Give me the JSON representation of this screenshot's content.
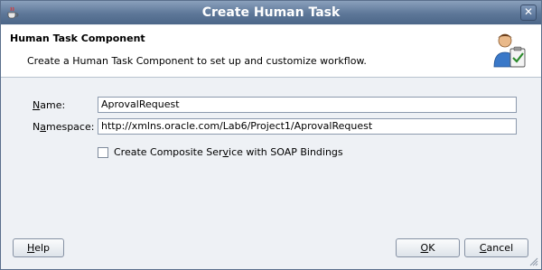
{
  "window": {
    "title": "Create Human Task"
  },
  "header": {
    "title": "Human Task Component",
    "description": "Create a Human Task Component to set up and customize workflow."
  },
  "form": {
    "name_label_mnemonic": "N",
    "name_label_rest": "ame:",
    "name_value": "AprovalRequest",
    "namespace_label_prefix": "N",
    "namespace_label_mnemonic": "a",
    "namespace_label_rest": "mespace:",
    "namespace_value": "http://xmlns.oracle.com/Lab6/Project1/AprovalRequest",
    "composite_checkbox_prefix": "Create Composite Ser",
    "composite_checkbox_mnemonic": "v",
    "composite_checkbox_rest": "ice with SOAP Bindings",
    "composite_checked": false
  },
  "buttons": {
    "help_mnemonic": "H",
    "help_rest": "elp",
    "ok_mnemonic": "O",
    "ok_rest": "K",
    "cancel_mnemonic": "C",
    "cancel_rest": "ancel"
  },
  "icons": {
    "app": "coffee-cup-icon",
    "header": "human-task-user-clipboard-icon",
    "close": "close-icon"
  }
}
